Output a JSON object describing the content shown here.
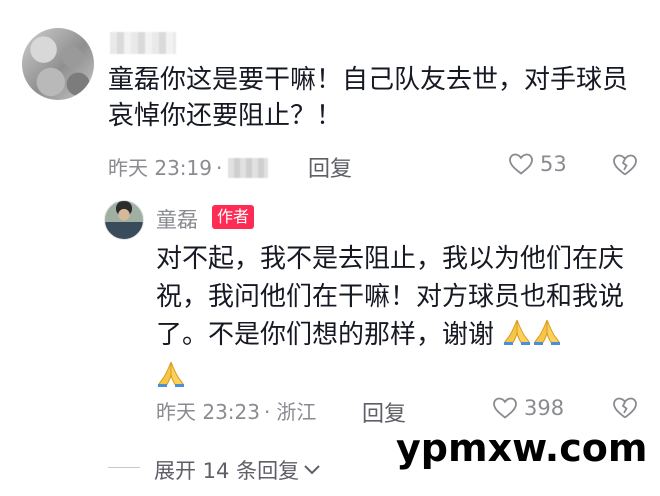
{
  "comment": {
    "text": "童磊你这是要干嘛！自己队友去世，对手球员哀悼你还要阻止？！",
    "time": "昨天 23:19",
    "reply_label": "回复",
    "likes": "53"
  },
  "reply": {
    "author": "童磊",
    "badge": "作者",
    "text": "对不起，我不是去阻止，我以为他们在庆祝，我问他们在干嘛！对方球员也和我说了。不是你们想的那样，谢谢",
    "time": "昨天 23:23",
    "location": "浙江",
    "reply_label": "回复",
    "likes": "398"
  },
  "expand": {
    "label": "展开 14 条回复"
  },
  "watermark": "ypmxw.com",
  "icons": {
    "like": "heart-outline-icon",
    "dislike": "broken-heart-icon",
    "pray": "folded-hands-emoji",
    "chevron": "chevron-down-icon"
  },
  "colors": {
    "author_badge": "#fe2c55",
    "meta_text": "#8a8b91"
  }
}
